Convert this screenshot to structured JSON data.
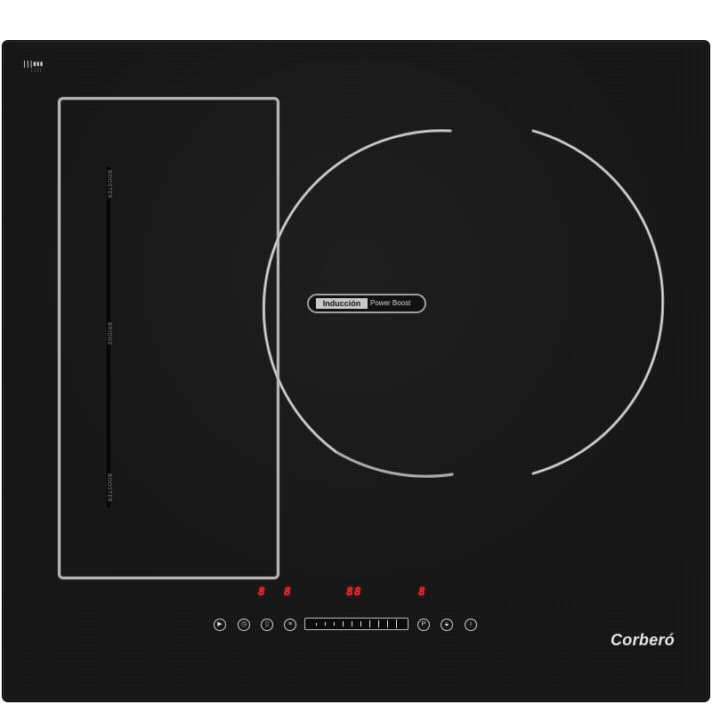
{
  "hob": {
    "brand_badge": {
      "icon": "tech-badge-icon"
    },
    "left_zone": {
      "labels": {
        "top": "BOOSTER",
        "middle": "BRIDGE",
        "bottom": "BOOSTER"
      }
    },
    "round_zone": {
      "badge": {
        "primary": "Inducción",
        "secondary": "Power Boost"
      }
    },
    "displays": {
      "d1": "8",
      "d2": "8",
      "d3": "88",
      "d4": "8"
    },
    "controls": {
      "play_pause_icon": "play-pause-icon",
      "timer_icon": "timer-icon",
      "zone_select_1_icon": "zone-select-icon",
      "zone_select_2_icon": "zone-grid-icon",
      "slider_ticks": 10,
      "pause_symbol": "P",
      "lock_icon": "lock-icon",
      "power_icon": "power-icon"
    },
    "logo_text": "Corberó",
    "colors": {
      "glass": "#141414",
      "display_red": "#ff2a2a",
      "outline": "#b4b4b4"
    }
  }
}
